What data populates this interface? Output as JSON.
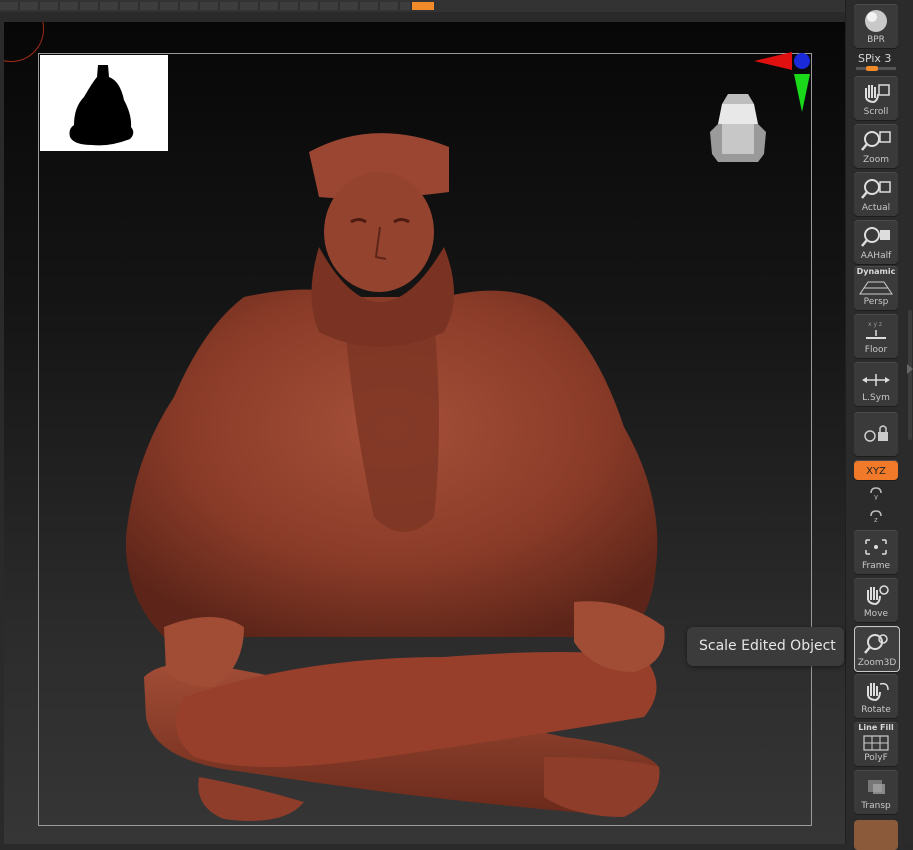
{
  "viewport": {
    "subject": "seated-bearded-figure-sculpt",
    "material_color": "#8c3a28"
  },
  "shelf": {
    "bpr": {
      "label": "BPR"
    },
    "spix": {
      "label": "SPix 3",
      "value": 3
    },
    "scroll": {
      "label": "Scroll"
    },
    "zoom": {
      "label": "Zoom"
    },
    "actual": {
      "label": "Actual"
    },
    "aahalf": {
      "label": "AAHalf"
    },
    "persp": {
      "top": "Dynamic",
      "label": "Persp"
    },
    "floor": {
      "label": "Floor"
    },
    "lsym": {
      "label": "L.Sym"
    },
    "xyz": {
      "label": "XYZ"
    },
    "frame": {
      "label": "Frame"
    },
    "move": {
      "label": "Move"
    },
    "zoom3d": {
      "label": "Zoom3D"
    },
    "rotate": {
      "label": "Rotate"
    },
    "polyf": {
      "top": "Line Fill",
      "label": "PolyF"
    },
    "transp": {
      "label": "Transp"
    }
  },
  "tooltip": {
    "text": "Scale Edited Object"
  },
  "colors": {
    "accent": "#f08a2a",
    "background": "#2a2a2a"
  }
}
